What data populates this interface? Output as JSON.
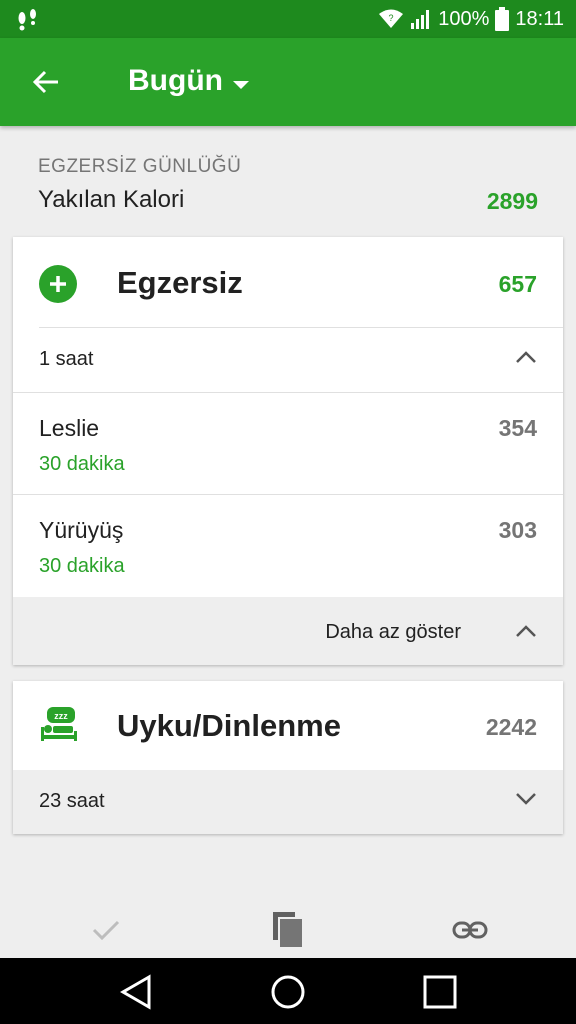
{
  "status_bar": {
    "battery_percent": "100%",
    "time": "18:11",
    "icons": [
      "notification-icon",
      "wifi-icon",
      "signal-icon",
      "battery-icon"
    ]
  },
  "app_bar": {
    "title": "Bugün",
    "icons": [
      "back-arrow-icon",
      "dropdown-arrow-icon"
    ]
  },
  "summary": {
    "section_label": "EGZERSİZ GÜNLÜĞÜ",
    "calorie_label": "Yakılan Kalori",
    "calorie_value": "2899"
  },
  "exercise_card": {
    "title": "Egzersiz",
    "total": "657",
    "duration": "1 saat",
    "entries": [
      {
        "name": "Leslie",
        "duration": "30 dakika",
        "calories": "354"
      },
      {
        "name": "Yürüyüş",
        "duration": "30 dakika",
        "calories": "303"
      }
    ],
    "show_less_label": "Daha az göster"
  },
  "sleep_card": {
    "title": "Uyku/Dinlenme",
    "total": "2242",
    "duration": "23 saat",
    "sleep_icon_text": "zzz"
  },
  "bottom_actions": [
    "check-icon",
    "copy-icon",
    "link-icon"
  ],
  "nav_bar": [
    "back-icon",
    "home-icon",
    "recents-icon"
  ],
  "colors": {
    "primary": "#2aa22a",
    "status_bar": "#1e8a1e",
    "secondary_text": "#757575"
  }
}
